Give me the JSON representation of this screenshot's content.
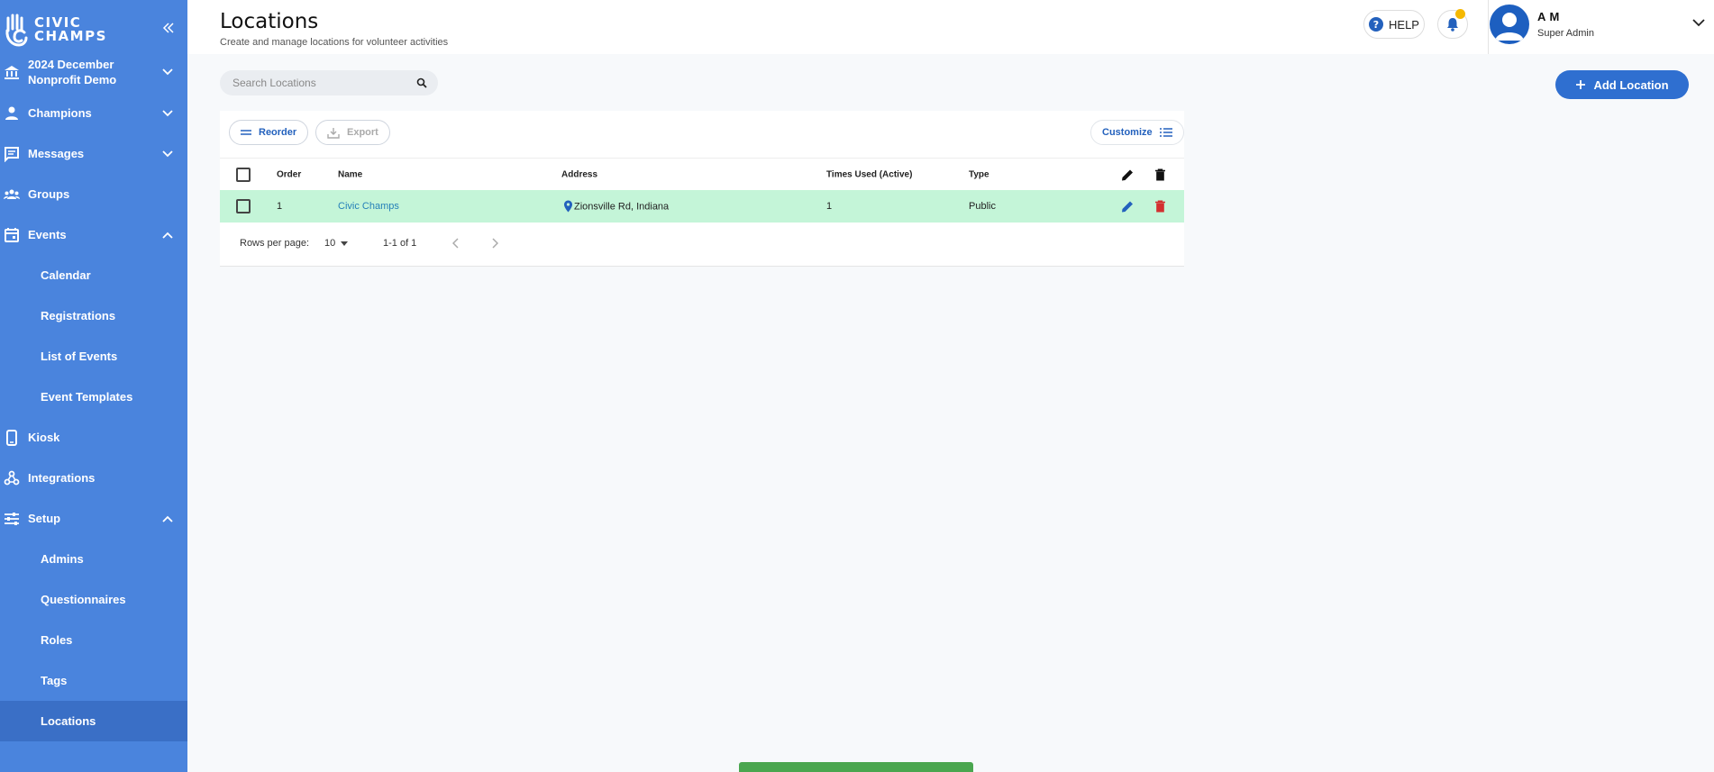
{
  "sidebar": {
    "logo_line1": "CIVIC",
    "logo_line2": "CHAMPS",
    "org_line1": "2024 December",
    "org_line2": "Nonprofit Demo",
    "items": {
      "champions": "Champions",
      "messages": "Messages",
      "groups": "Groups",
      "events": "Events",
      "calendar": "Calendar",
      "registrations": "Registrations",
      "list_of_events": "List of Events",
      "event_templates": "Event Templates",
      "kiosk": "Kiosk",
      "integrations": "Integrations",
      "setup": "Setup",
      "admins": "Admins",
      "questionnaires": "Questionnaires",
      "roles": "Roles",
      "tags": "Tags",
      "locations": "Locations"
    }
  },
  "header": {
    "title": "Locations",
    "subtitle": "Create and manage locations for volunteer activities",
    "help_label": "HELP",
    "user_name": "A M",
    "user_role": "Super Admin"
  },
  "search": {
    "placeholder": "Search Locations",
    "value": ""
  },
  "toolbar": {
    "add_location": "Add Location",
    "reorder": "Reorder",
    "export": "Export",
    "customize": "Customize"
  },
  "table": {
    "columns": {
      "order": "Order",
      "name": "Name",
      "address": "Address",
      "times_used": "Times Used (Active)",
      "type": "Type"
    },
    "rows": [
      {
        "order": "1",
        "name": "Civic Champs",
        "address": "Zionsville Rd, Indiana",
        "times_used": "1",
        "type": "Public"
      }
    ]
  },
  "pagination": {
    "rows_per_page_label": "Rows per page:",
    "rows_per_page": "10",
    "range": "1-1 of 1"
  },
  "colors": {
    "sidebar": "#4a84dd",
    "sidebar_active": "#3a6fc6",
    "primary": "#2f6fd0",
    "row_highlight": "#c4f5d8",
    "delete": "#d32f2f",
    "notification_dot": "#f5b800"
  }
}
